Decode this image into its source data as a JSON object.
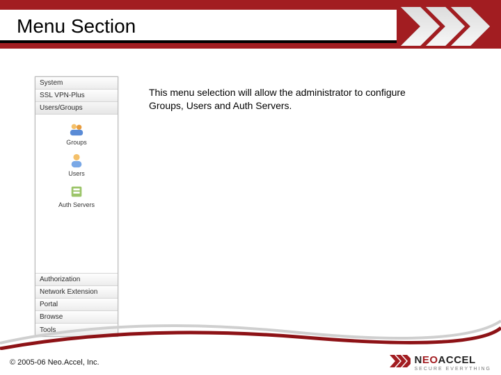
{
  "header": {
    "title": "Menu Section"
  },
  "menu": {
    "items": [
      {
        "label": "System"
      },
      {
        "label": "SSL VPN-Plus"
      },
      {
        "label": "Users/Groups",
        "selected": true
      },
      {
        "label": "Authorization"
      },
      {
        "label": "Network Extension"
      },
      {
        "label": "Portal"
      },
      {
        "label": "Browse"
      },
      {
        "label": "Tools"
      }
    ],
    "sub": [
      {
        "label": "Groups"
      },
      {
        "label": "Users"
      },
      {
        "label": "Auth Servers"
      }
    ]
  },
  "explain": "This menu selection will allow the administrator to configure Groups, Users and Auth Servers.",
  "footer": {
    "copyright": "© 2005-06 Neo.Accel, Inc.",
    "brand": {
      "name_pre": "N",
      "name_accent": "EO",
      "name_post": "ACCEL",
      "tagline": "SECURE EVERYTHING"
    }
  }
}
